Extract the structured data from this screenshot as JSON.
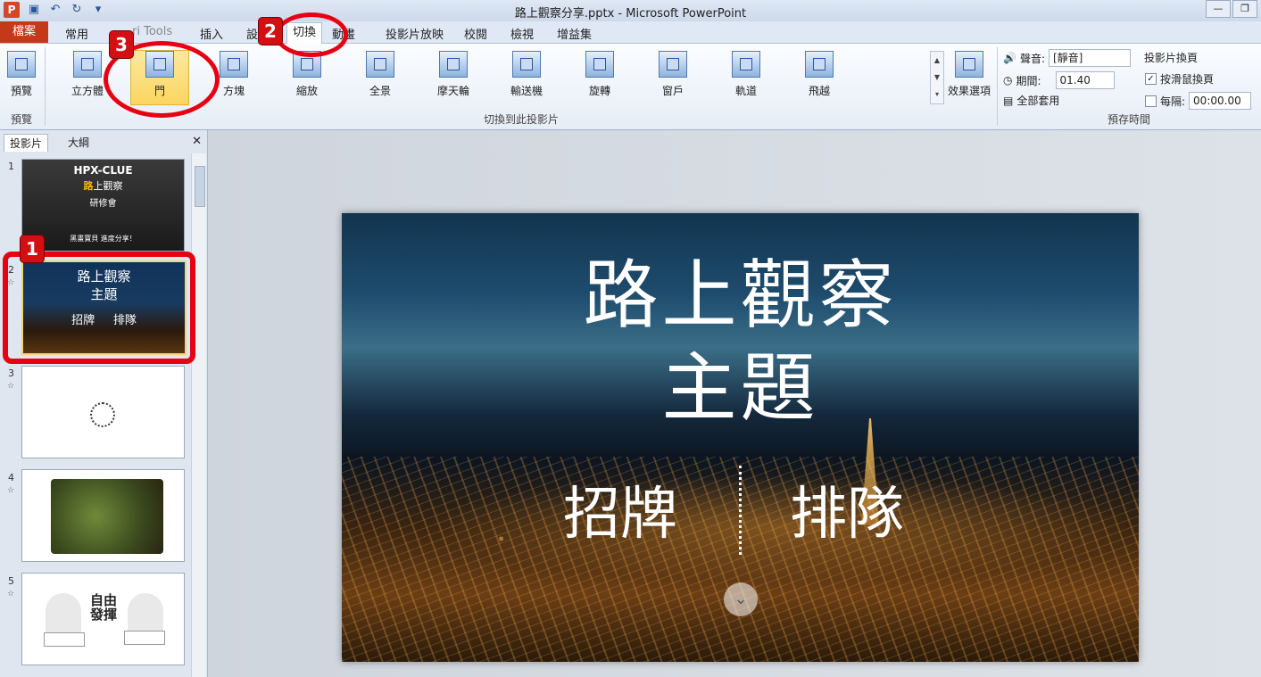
{
  "window": {
    "title": "路上觀察分享.pptx - Microsoft PowerPoint",
    "app_logo": "P",
    "controls": [
      "—",
      "❐",
      "✕"
    ]
  },
  "tabs": [
    {
      "label": "檔案"
    },
    {
      "label": "常用"
    },
    {
      "label": "ri Tools"
    },
    {
      "label": "插入"
    },
    {
      "label": "設"
    },
    {
      "label": "切換"
    },
    {
      "label": "動畫"
    },
    {
      "label": "投影片放映"
    },
    {
      "label": "校閱"
    },
    {
      "label": "檢視"
    },
    {
      "label": "增益集"
    }
  ],
  "ribbon": {
    "preview": {
      "label": "預覽",
      "group": "預覽"
    },
    "transitions": [
      "立方體",
      "門",
      "方塊",
      "縮放",
      "全景",
      "摩天輪",
      "輸送機",
      "旋轉",
      "窗戶",
      "軌道",
      "飛越"
    ],
    "transition_group": "切換到此投影片",
    "effect_options": "效果選項",
    "timing": {
      "sound_label": "聲音:",
      "sound_value": "[靜音]",
      "duration_label": "期間:",
      "duration_value": "01.40",
      "apply_all": "全部套用",
      "advance_title": "投影片換頁",
      "on_click": "按滑鼠換頁",
      "after": "每隔:",
      "after_value": "00:00.00",
      "group": "預存時間"
    }
  },
  "panel": {
    "tabs": [
      "投影片",
      "大綱"
    ],
    "slides": [
      {
        "num": "1",
        "line1": "HPX-CLUE",
        "line2a": "路",
        "line2b": "上觀察",
        "line3": "研修會",
        "line4": "黑畫寶貝 進度分享！"
      },
      {
        "num": "2",
        "title": "路上觀察",
        "subtitle": "主題",
        "left": "招牌",
        "right": "排隊"
      },
      {
        "num": "3"
      },
      {
        "num": "4"
      },
      {
        "num": "5",
        "mid": "自由發揮"
      }
    ]
  },
  "slide": {
    "line1": "路上觀察",
    "line2": "主題",
    "left": "招牌",
    "right": "排隊"
  },
  "annotations": {
    "one": "1",
    "two": "2",
    "three": "3"
  }
}
